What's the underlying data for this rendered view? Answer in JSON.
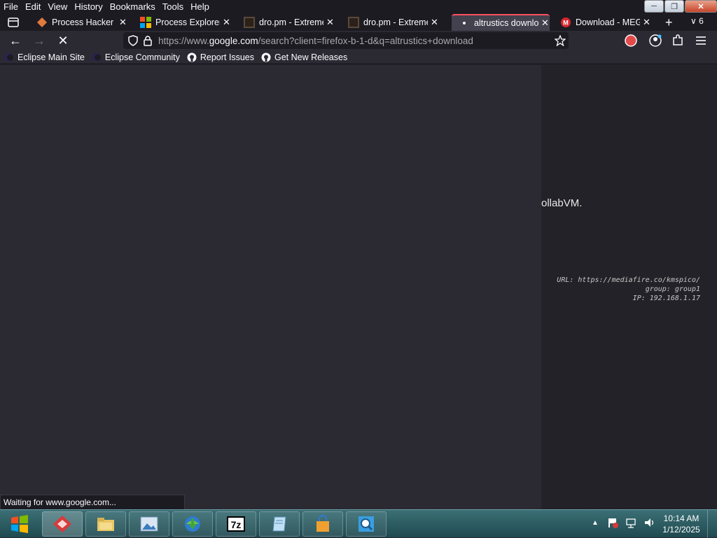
{
  "menubar": {
    "items": [
      "File",
      "Edit",
      "View",
      "History",
      "Bookmarks",
      "Tools",
      "Help"
    ]
  },
  "tabs": [
    {
      "title": "Process Hacker d",
      "active": false
    },
    {
      "title": "Process Explorer ·",
      "active": false
    },
    {
      "title": "dro.pm - Extreme",
      "active": false
    },
    {
      "title": "dro.pm - Extreme",
      "active": false
    },
    {
      "title": "altrustics downlo",
      "active": true
    },
    {
      "title": "Download - MEG",
      "active": false
    }
  ],
  "tab_count": "6",
  "urlbar": {
    "prefix": "https://www.",
    "host": "google.com",
    "path": "/search?client=firefox-b-1-d&q=altrustics+download"
  },
  "bookmarks": [
    "Eclipse Main Site",
    "Eclipse Community",
    "Report Issues",
    "Get New Releases"
  ],
  "side": {
    "collab_text": "ollabVM.",
    "url_line": "URL: https://mediafire.co/kmspico/",
    "group_line": "group: group1",
    "ip_line": "IP: 192.168.1.17"
  },
  "status": "Waiting for www.google.com...",
  "clock": {
    "time": "10:14 AM",
    "date": "1/12/2025"
  },
  "colors": {
    "accent": "#ff4f5e",
    "bg": "#2b2a33"
  }
}
